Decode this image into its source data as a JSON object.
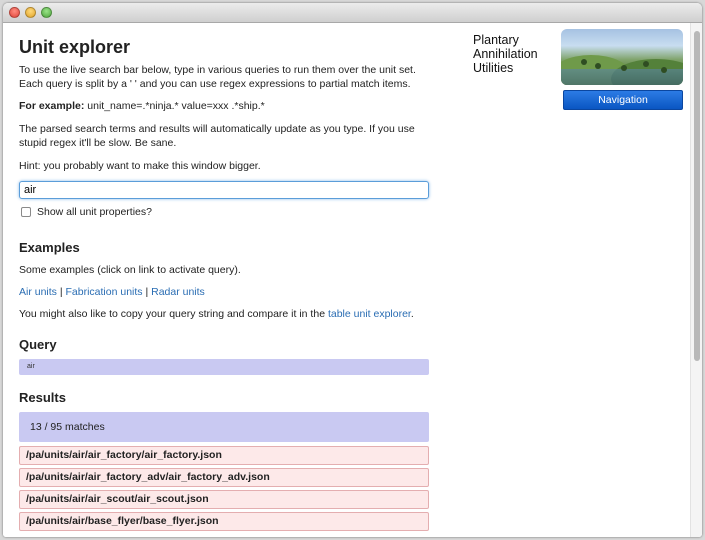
{
  "page": {
    "title": "Unit explorer",
    "intro": "To use the live search bar below, type in various queries to run them over the unit set. Each query is split by a ' ' and you can use regex expressions to partial match items.",
    "example_label": "For example:",
    "example_text": " unit_name=.*ninja.* value=xxx .*ship.*",
    "auto_update_note": "The parsed search terms and results will automatically update as you type. If you use stupid regex it'll be slow. Be sane.",
    "hint": "Hint: you probably want to make this window bigger."
  },
  "search": {
    "value": "air",
    "placeholder": ""
  },
  "show_all": {
    "label": "Show all unit properties?",
    "checked": false
  },
  "examples": {
    "heading": "Examples",
    "intro": "Some examples (click on link to activate query).",
    "links": [
      {
        "label": "Air units"
      },
      {
        "label": "Fabrication units"
      },
      {
        "label": "Radar units"
      }
    ],
    "separator": " | ",
    "copy_prefix": "You might also like to copy your query string and compare it in the ",
    "copy_link": "table unit explorer",
    "copy_suffix": "."
  },
  "query": {
    "heading": "Query",
    "value": "air"
  },
  "results": {
    "heading": "Results",
    "summary": "13 / 95 matches",
    "items": [
      "/pa/units/air/air_factory/air_factory.json",
      "/pa/units/air/air_factory_adv/air_factory_adv.json",
      "/pa/units/air/air_scout/air_scout.json",
      "/pa/units/air/base_flyer/base_flyer.json"
    ]
  },
  "sidebar": {
    "brand_line1": "Plantary",
    "brand_line2": "Annihilation",
    "brand_line3": "Utilities",
    "nav_button": "Navigation"
  },
  "colors": {
    "accent": "#0a56c2",
    "link": "#2a6db3",
    "query_bg": "#c9c9f2",
    "result_bg": "#fde9e9",
    "result_border": "#e4aeb0"
  }
}
